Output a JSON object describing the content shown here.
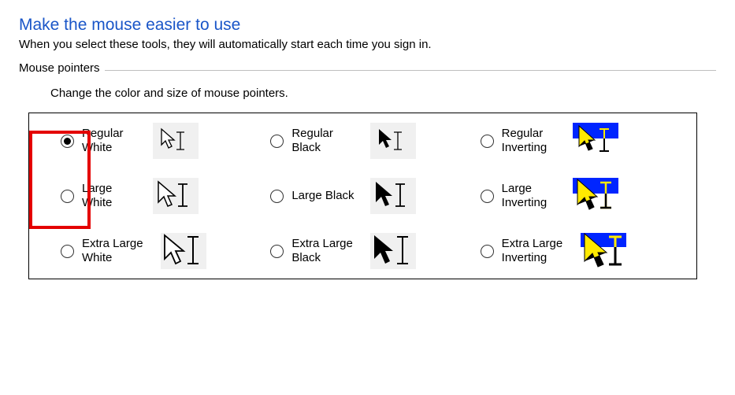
{
  "page": {
    "title": "Make the mouse easier to use",
    "subtitle": "When you select these tools, they will automatically start each time you sign in."
  },
  "group": {
    "label": "Mouse pointers",
    "description": "Change the color and size of mouse pointers."
  },
  "options": {
    "regular_white": "Regular White",
    "large_white": "Large White",
    "extra_large_white": "Extra Large White",
    "regular_black": "Regular Black",
    "large_black": "Large Black",
    "extra_large_black": "Extra Large Black",
    "regular_inverting": "Regular Inverting",
    "large_inverting": "Large Inverting",
    "extra_large_inverting": "Extra Large Inverting"
  },
  "selected": "regular_white"
}
